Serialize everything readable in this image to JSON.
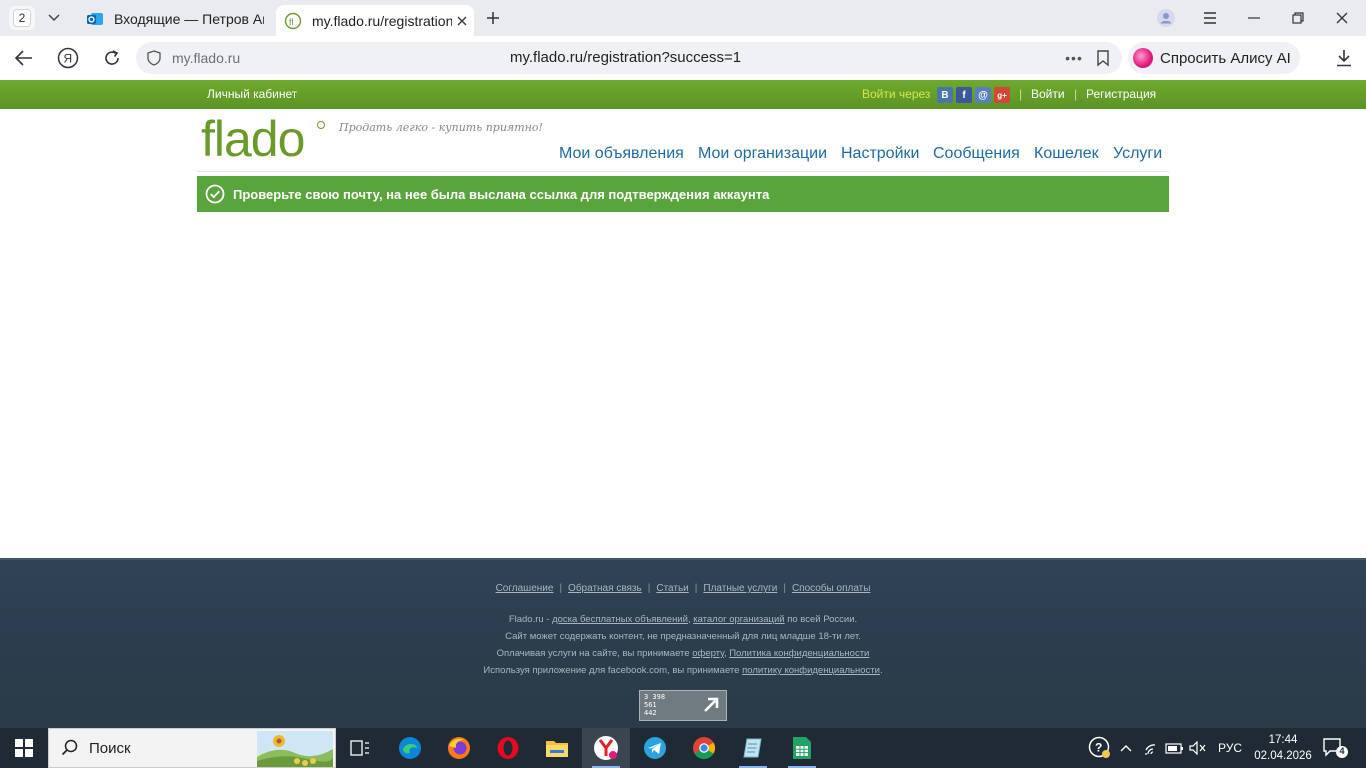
{
  "browser": {
    "tab_count": "2",
    "tabs": [
      {
        "title": "Входящие — Петров Анто",
        "icon": "outlook-icon"
      },
      {
        "title": "my.flado.ru/registration",
        "icon": "flado-icon",
        "active": true
      }
    ],
    "address": {
      "domain": "my.flado.ru",
      "url": "my.flado.ru/registration?success=1"
    },
    "alice_label": "Спросить Алису AI"
  },
  "site": {
    "topbar": {
      "cabinet": "Личный кабинет",
      "login_via": "Войти через",
      "social": [
        "В",
        "f",
        "@",
        "g+"
      ],
      "separator": "|",
      "login": "Войти",
      "register": "Регистрация"
    },
    "logo": "flado",
    "slogan": "Продать легко - купить приятно!",
    "nav": [
      "Мои объявления",
      "Мои организации",
      "Настройки",
      "Сообщения",
      "Кошелек",
      "Услуги"
    ],
    "notice": "Проверьте свою почту, на нее была выслана ссылка для подтверждения аккаунта",
    "footer": {
      "links": [
        "Соглашение",
        "Обратная связь",
        "Статьи",
        "Платные услуги",
        "Способы оплаты"
      ],
      "line1_prefix": "Flado.ru - ",
      "line1_link1": "доска бесплатных объявлений",
      "line1_comma": ", ",
      "line1_link2": "каталог организаций",
      "line1_suffix": " по всей России.",
      "line2": "Сайт может содержать контент, не предназначенный для лиц младше 18-ти лет.",
      "line3_prefix": "Оплачивая услуги на сайте, вы принимаете ",
      "line3_link1": "оферту",
      "line3_comma": ", ",
      "line3_link2": "Политика конфиденциальности",
      "line4_prefix": "Используя приложение для facebook.com, вы принимаете ",
      "line4_link": "политику конфиденциальности",
      "line4_suffix": ".",
      "counter": [
        "3 398",
        "561",
        "442"
      ]
    }
  },
  "taskbar": {
    "search_placeholder": "Поиск",
    "lang": "РУС",
    "time": "17:44",
    "date": "02.04.2026",
    "notifications": "4"
  }
}
